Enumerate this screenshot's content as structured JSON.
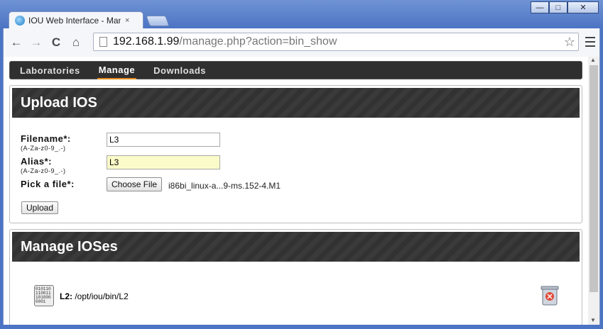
{
  "browser": {
    "tab_title": "IOU Web Interface - Man",
    "tab_close": "×",
    "url_host": "192.168.1.99",
    "url_path": "/manage.php?action=bin_show",
    "win_minimize": "—",
    "win_maximize": "□",
    "win_close": "✕",
    "back": "←",
    "forward": "→",
    "reload": "C",
    "home": "⌂",
    "star": "☆"
  },
  "nav": {
    "items": [
      {
        "label": "Laboratories"
      },
      {
        "label": "Manage"
      },
      {
        "label": "Downloads"
      }
    ],
    "active_index": 1
  },
  "upload": {
    "title": "Upload IOS",
    "filename_label": "Filename*:",
    "filename_hint": "(A-Za-z0-9_.-)",
    "filename_value": "L3",
    "alias_label": "Alias*:",
    "alias_hint": "(A-Za-z0-9_.-)",
    "alias_value": "L3",
    "file_label": "Pick a file*:",
    "choose_file_button": "Choose File",
    "chosen_file": "i86bi_linux-a...9-ms.152-4.M1",
    "upload_button": "Upload"
  },
  "manage": {
    "title": "Manage IOSes",
    "items": [
      {
        "name": "L2:",
        "path": "/opt/iou/bin/L2"
      }
    ]
  },
  "colors": {
    "nav_active_underline": "#e38b1b",
    "header_bg": "#333333",
    "alias_highlight": "#fbfbc9"
  }
}
